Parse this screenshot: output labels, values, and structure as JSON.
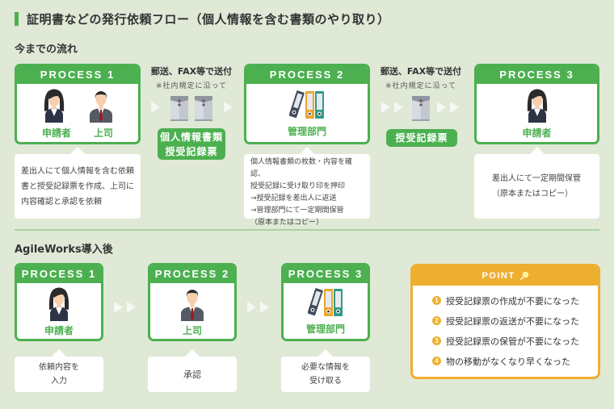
{
  "title": "証明書などの発行依頼フロー（個人情報を含む書類のやり取り）",
  "before": {
    "heading": "今までの流れ",
    "process1": {
      "label": "PROCESS 1",
      "roles": [
        "申請者",
        "上司"
      ],
      "icons": [
        "woman-icon",
        "man-icon"
      ],
      "note": "差出人にて個人情報を含む依頼書と授受記録票を作成、上司に内容確認と承認を依頼"
    },
    "send1": {
      "heading": "郵送、FAX等で送付",
      "sub": "※社内規定に沿って",
      "badge_lines": [
        "個人情報書類",
        "授受記録票"
      ]
    },
    "process2": {
      "label": "PROCESS 2",
      "role": "管理部門",
      "note_lines": [
        "個人情報書類の枚数・内容を確認、",
        "授受記録に受け取り印を押印",
        "→授受記録を差出人に返送",
        "→管理部門にて一定期間保管",
        "（原本またはコピー）"
      ]
    },
    "send2": {
      "heading": "郵送、FAX等で送付",
      "sub": "※社内規定に沿って",
      "badge": "授受記録票"
    },
    "process3": {
      "label": "PROCESS 3",
      "role": "申請者",
      "note_lines": [
        "差出人にて一定期間保管",
        "（原本またはコピー）"
      ]
    }
  },
  "after": {
    "heading": "AgileWorks導入後",
    "process1": {
      "label": "PROCESS 1",
      "role": "申請者",
      "note_lines": [
        "依頼内容を",
        "入力"
      ]
    },
    "process2": {
      "label": "PROCESS 2",
      "role": "上司",
      "note": "承認"
    },
    "process3": {
      "label": "PROCESS 3",
      "role": "管理部門",
      "note_lines": [
        "必要な情報を",
        "受け取る"
      ]
    }
  },
  "point": {
    "label": "POINT",
    "items": [
      {
        "num": "1",
        "text": "授受記録票の作成が不要になった"
      },
      {
        "num": "2",
        "text": "授受記録票の返送が不要になった"
      },
      {
        "num": "3",
        "text": "授受記録票の保管が不要になった"
      },
      {
        "num": "4",
        "text": "物の移動がなくなり早くなった"
      }
    ]
  },
  "colors": {
    "background": "#dfe9d6",
    "green": "#4cb050",
    "orange": "#eeaf31",
    "divider": "#a9d39e"
  }
}
